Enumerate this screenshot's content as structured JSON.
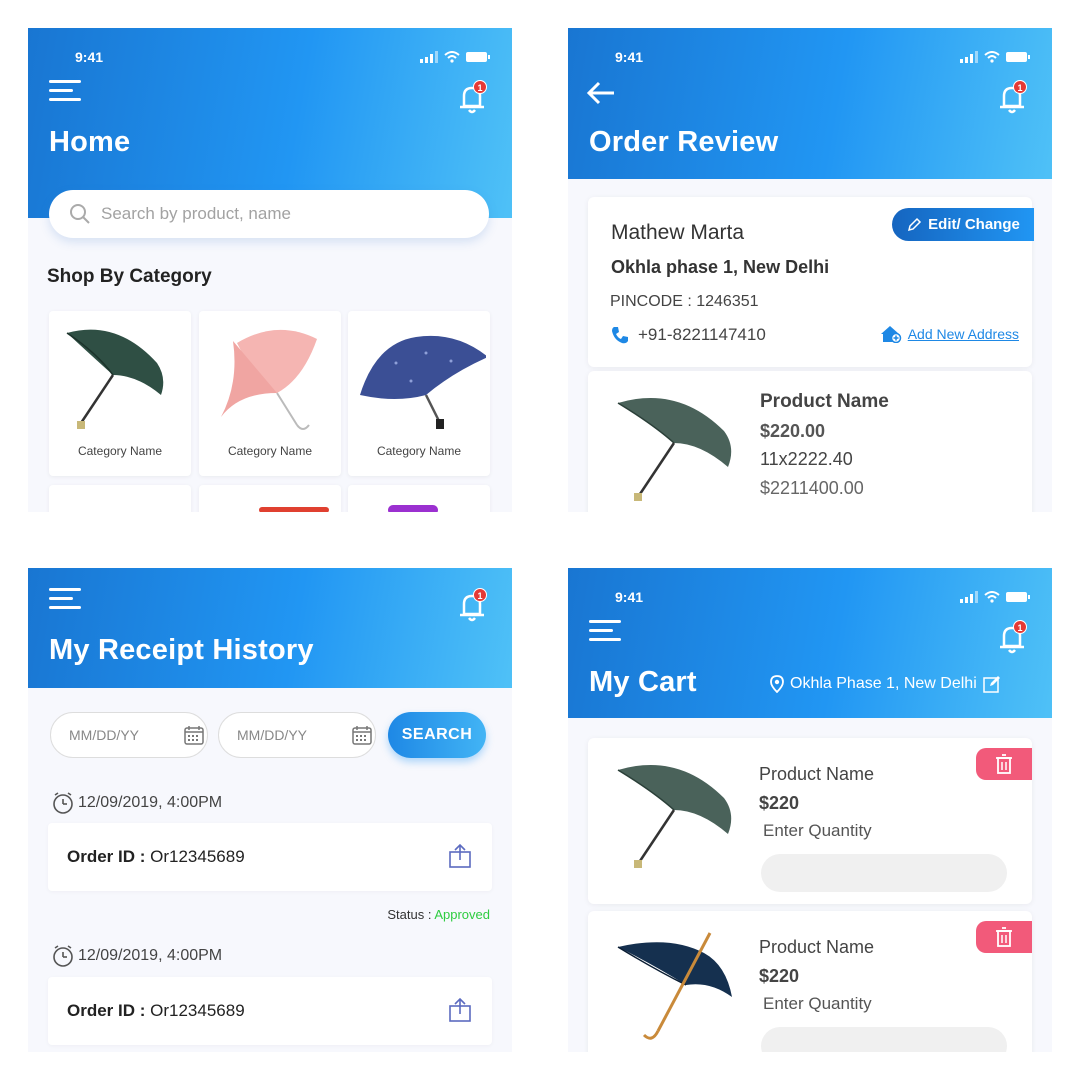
{
  "screens": {
    "home": {
      "time": "9:41",
      "title": "Home",
      "notification_count": "1",
      "search": {
        "placeholder": "Search by product, name"
      },
      "section_title": "Shop By Category",
      "categories": [
        {
          "label": "Category Name",
          "icon": "dark-green-umbrella-icon"
        },
        {
          "label": "Category Name",
          "icon": "pink-umbrella-icon"
        },
        {
          "label": "Category Name",
          "icon": "blue-umbrella-icon"
        }
      ]
    },
    "order_review": {
      "time": "9:41",
      "title": "Order Review",
      "notification_count": "1",
      "address": {
        "name": "Mathew Marta",
        "line": "Okhla phase 1, New Delhi",
        "pincode": "PINCODE : 1246351",
        "phone": "+91-8221147410",
        "edit_label": "Edit/ Change",
        "add_new_label": "Add New Address"
      },
      "product": {
        "name": "Product Name",
        "price": "$220.00",
        "quantity": "11x2222.40",
        "total": "$2211400.00"
      }
    },
    "receipt_history": {
      "title": "My Receipt History",
      "notification_count": "1",
      "date_placeholder": "MM/DD/YY",
      "search_label": "SEARCH",
      "receipts": [
        {
          "datetime": "12/09/2019, 4:00PM",
          "order_label": "Order ID :",
          "order_id": "Or12345689",
          "status_label": "Status :",
          "status": "Approved"
        },
        {
          "datetime": "12/09/2019, 4:00PM",
          "order_label": "Order ID :",
          "order_id": "Or12345689"
        }
      ]
    },
    "cart": {
      "time": "9:41",
      "title": "My Cart",
      "notification_count": "1",
      "location": "Okhla Phase 1, New Delhi",
      "items": [
        {
          "name": "Product Name",
          "price": "$220",
          "quantity_label": "Enter Quantity"
        },
        {
          "name": "Product Name",
          "price": "$220",
          "quantity_label": "Enter Quantity"
        }
      ]
    }
  },
  "colors": {
    "header_start": "#1976d2",
    "header_end": "#4fc1f7",
    "badge": "#e53935",
    "approved": "#2ecc40",
    "delete": "#f25a7a",
    "link": "#1e88e5"
  }
}
